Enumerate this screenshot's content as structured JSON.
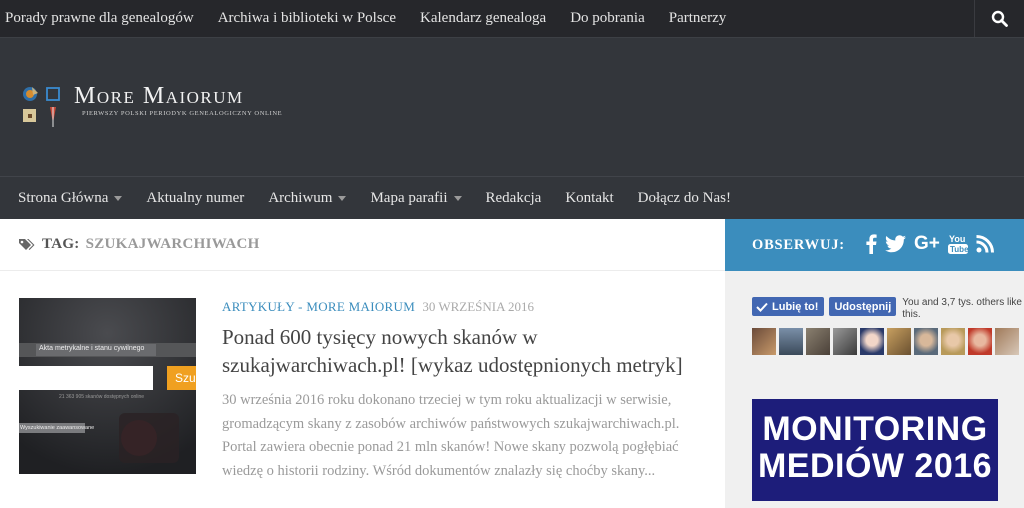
{
  "topbar": {
    "links": [
      "Porady prawne dla genealogów",
      "Archiwa i biblioteki w Polsce",
      "Kalendarz genealoga",
      "Do pobrania",
      "Partnerzy"
    ],
    "search_icon": "search-icon"
  },
  "header": {
    "logo_title": "More Maiorum",
    "logo_subtitle": "Pierwszy polski periodyk genealogiczny online"
  },
  "mainnav": {
    "items": [
      {
        "label": "Strona Główna",
        "dropdown": true
      },
      {
        "label": "Aktualny numer",
        "dropdown": false
      },
      {
        "label": "Archiwum",
        "dropdown": true
      },
      {
        "label": "Mapa parafii",
        "dropdown": true
      },
      {
        "label": "Redakcja",
        "dropdown": false
      },
      {
        "label": "Kontakt",
        "dropdown": false
      },
      {
        "label": "Dołącz do Nas!",
        "dropdown": false
      }
    ]
  },
  "tagbar": {
    "prefix": "TAG:",
    "tag": "SZUKAJWARCHIWACH"
  },
  "post": {
    "category": "ARTYKUŁY - MORE MAIORUM",
    "date": "30 WRZEŚNIA 2016",
    "title": "Ponad 600 tysięcy nowych skanów w szukajwarchiwach.pl! [wykaz udostępnionych metryk]",
    "excerpt": "30 września 2016 roku dokonano trzeciej w tym roku aktualizacji  w serwisie, gromadzącym skany z zasobów archiwów państwowych szukajwarchiwach.pl. Portal zawiera obecnie ponad 21 mln skanów! Nowe skany pozwolą pogłębiać wiedzę o historii rodziny. Wśród dokumentów znalazły się choćby skany...",
    "thumb": {
      "tab": "Akta metrykalne i stanu cywilnego",
      "button": "Szu",
      "count": "21 363 905 skanów dostępnych online",
      "advanced": "Wyszukiwanie zaawansowane"
    }
  },
  "sidebar": {
    "follow_label": "OBSERWUJ:",
    "social_icons": [
      "facebook-icon",
      "twitter-icon",
      "google-plus-icon",
      "youtube-icon",
      "rss-icon"
    ],
    "fb_like": "Lubię to!",
    "fb_share": "Udostępnij",
    "fb_text": "You and 3,7 tys. others like this.",
    "banner_line1": "MONITORING",
    "banner_line2": "MEDIÓW 2016"
  },
  "colors": {
    "accent": "#3b8dbd",
    "topbar": "#26272b",
    "header": "#33363b",
    "fb": "#4267b2",
    "banner": "#1d1d7a"
  }
}
